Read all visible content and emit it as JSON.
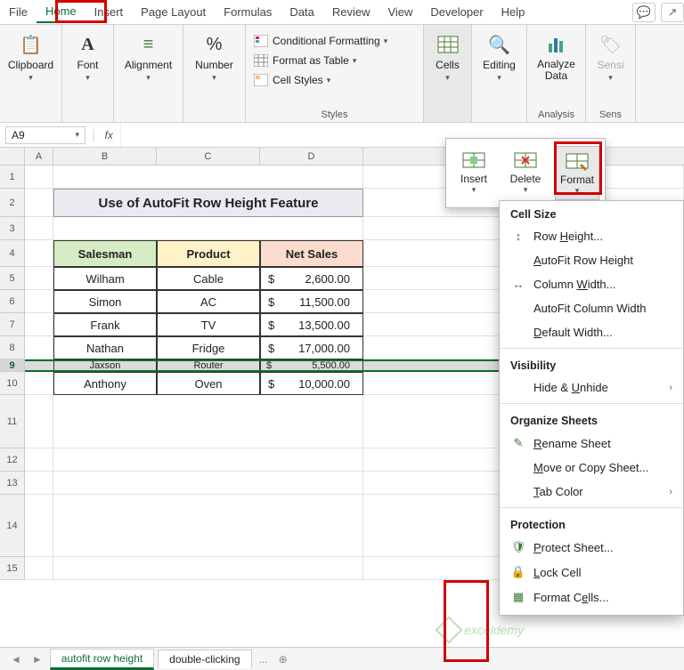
{
  "tabs": {
    "file": "File",
    "home": "Home",
    "insert": "Insert",
    "pagelayout": "Page Layout",
    "formulas": "Formulas",
    "data": "Data",
    "review": "Review",
    "view": "View",
    "developer": "Developer",
    "help": "Help"
  },
  "ribbon": {
    "clipboard": "Clipboard",
    "font": "Font",
    "alignment": "Alignment",
    "number": "Number",
    "cond": "Conditional Formatting",
    "fmt_table": "Format as Table",
    "cell_styles": "Cell Styles",
    "styles": "Styles",
    "cells": "Cells",
    "editing": "Editing",
    "analyze": "Analyze Data",
    "analysis": "Analysis",
    "sens": "Sensi",
    "sens_g": "Sens"
  },
  "namebox": "A9",
  "fx": "fx",
  "cols": [
    "A",
    "B",
    "C",
    "D"
  ],
  "title": "Use of AutoFit Row Height Feature",
  "hdr": {
    "s": "Salesman",
    "p": "Product",
    "n": "Net Sales"
  },
  "rows": [
    {
      "s": "Wilham",
      "p": "Cable",
      "d": "$",
      "v": "2,600.00"
    },
    {
      "s": "Simon",
      "p": "AC",
      "d": "$",
      "v": "11,500.00"
    },
    {
      "s": "Frank",
      "p": "TV",
      "d": "$",
      "v": "13,500.00"
    },
    {
      "s": "Nathan",
      "p": "Fridge",
      "d": "$",
      "v": "17,000.00"
    },
    {
      "s": "Jaxson",
      "p": "Router",
      "d": "$",
      "v": "5,500.00"
    },
    {
      "s": "Anthony",
      "p": "Oven",
      "d": "$",
      "v": "10,000.00"
    }
  ],
  "rownums": [
    "1",
    "2",
    "3",
    "4",
    "5",
    "6",
    "7",
    "8",
    "9",
    "10",
    "11",
    "12",
    "13",
    "14",
    "15"
  ],
  "popup": {
    "insert": "Insert",
    "delete": "Delete",
    "format": "Format"
  },
  "menu": {
    "cellsize": "Cell Size",
    "rowh": "Row Height...",
    "autorow": "AutoFit Row Height",
    "colw": "Column Width...",
    "autocol": "AutoFit Column Width",
    "defw": "Default Width...",
    "vis": "Visibility",
    "hide": "Hide & Unhide",
    "org": "Organize Sheets",
    "rename": "Rename Sheet",
    "move": "Move or Copy Sheet...",
    "tabc": "Tab Color",
    "prot": "Protection",
    "protect": "Protect Sheet...",
    "lock": "Lock Cell",
    "fcells": "Format Cells..."
  },
  "sheets": {
    "s1": "autofit row height",
    "s2": "double-clicking",
    "more": "...",
    "nav_l": "◄",
    "nav_r": "►",
    "add": "⊕"
  },
  "wm": "exceldemy"
}
